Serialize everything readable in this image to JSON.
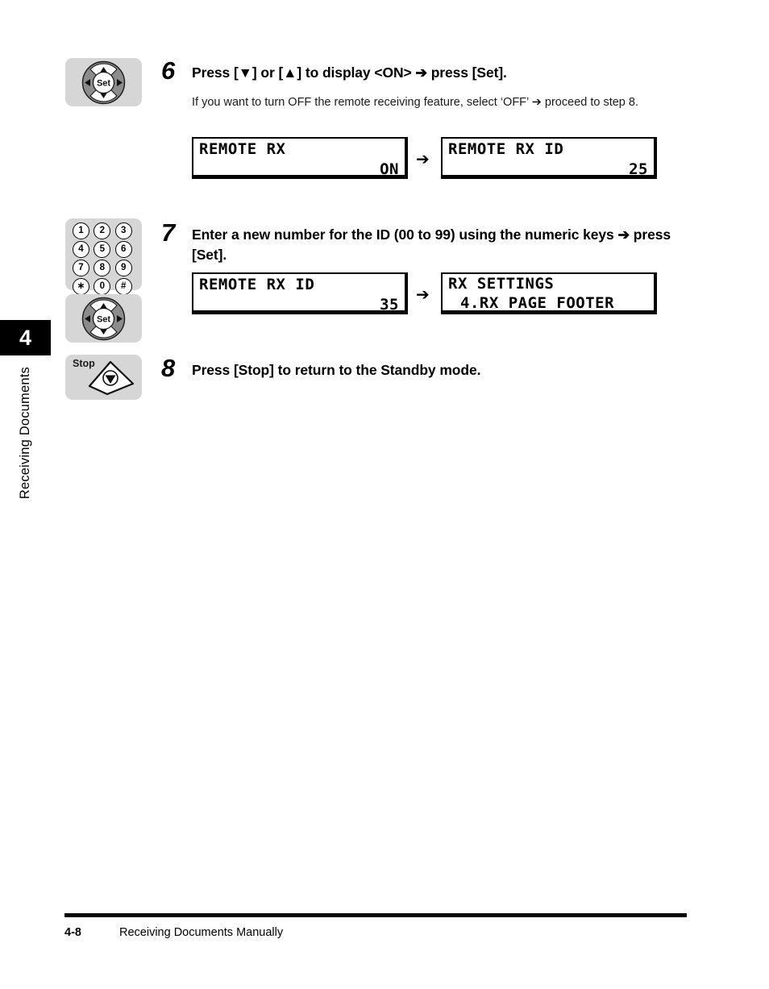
{
  "chapter": {
    "number": "4",
    "label": "Receiving Documents"
  },
  "steps": [
    {
      "number": "6",
      "icon": "nav-set-dial",
      "icon_center_label": "Set",
      "title": "Press [▼] or [▲] to display <ON> ➔ press [Set].",
      "body": "If you want to turn OFF the remote receiving feature, select ‘OFF’ ➔ proceed to step 8.",
      "arrow": "➔",
      "displays": [
        {
          "line1": "REMOTE RX",
          "value": "ON",
          "value_cursor": ""
        },
        {
          "line1": "REMOTE RX ID",
          "value": "2",
          "value_cursor": "5"
        }
      ]
    },
    {
      "number": "7",
      "icon": "numeric-keypad",
      "keys": [
        "1",
        "2",
        "3",
        "4",
        "5",
        "6",
        "7",
        "8",
        "9",
        "∗",
        "0",
        "#"
      ],
      "icon2": "nav-set-dial",
      "icon_center_label": "Set",
      "title": "Enter a new number for the ID (00 to 99) using the numeric keys ➔ press [Set].",
      "arrow": "➔",
      "displays": [
        {
          "line1": "REMOTE RX ID",
          "value": "3",
          "value_cursor": "5"
        },
        {
          "line1": "RX SETTINGS",
          "line2": "4.RX PAGE FOOTER"
        }
      ]
    },
    {
      "number": "8",
      "icon": "stop-key",
      "icon_label": "Stop",
      "title": "Press [Stop] to return to the Standby mode."
    }
  ],
  "footer": {
    "page": "4-8",
    "title": "Receiving Documents Manually"
  },
  "colors": {
    "panel_gray": "#d6d6d6",
    "dial_gray": "#8c8c8c",
    "black": "#000000"
  }
}
